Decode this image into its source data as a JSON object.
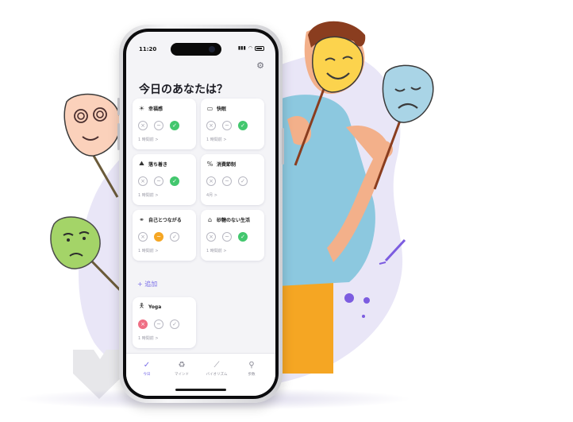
{
  "status": {
    "time": "11:20"
  },
  "screen": {
    "title": "今日のあなたは？"
  },
  "cards": [
    {
      "icon": "sun-icon",
      "label": "幸福感",
      "time": "1 時間前 >",
      "state": "ok"
    },
    {
      "icon": "bed-icon",
      "label": "快眠",
      "time": "1 時間前 >",
      "state": "ok"
    },
    {
      "icon": "mountain-icon",
      "label": "落ち着き",
      "time": "1 時間前 >",
      "state": "ok"
    },
    {
      "icon": "percent-icon",
      "label": "消費節制",
      "time": "4月 >",
      "state": "none"
    },
    {
      "icon": "people-icon",
      "label": "自己とつながる",
      "time": "1 時間前 >",
      "state": "wave"
    },
    {
      "icon": "cake-icon",
      "label": "砂糖のない生活",
      "time": "1 時間前 >",
      "state": "ok"
    },
    {
      "icon": "yoga-icon",
      "label": "Yoga",
      "time": "1 時間前 >",
      "state": "x"
    }
  ],
  "add_label": "+ 追加",
  "tabs": [
    {
      "label": "今日",
      "icon": "check-circle-icon",
      "active": true
    },
    {
      "label": "マインド",
      "icon": "recycle-icon",
      "active": false
    },
    {
      "label": "バイオリズム",
      "icon": "chart-icon",
      "active": false
    },
    {
      "label": "歩数",
      "icon": "walk-icon",
      "active": false
    }
  ],
  "colors": {
    "accent": "#7a6ee8",
    "ok": "#43c76e",
    "wave": "#f5a623",
    "x": "#ef6f84"
  }
}
